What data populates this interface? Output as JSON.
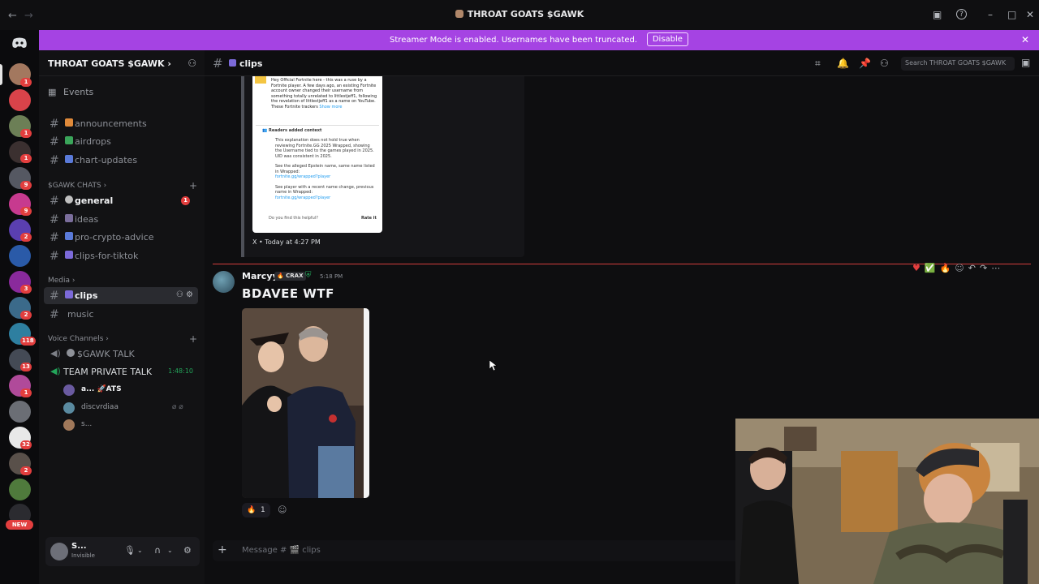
{
  "window": {
    "title": "THROAT GOATS $GAWK",
    "nav_back": "←",
    "nav_forward": "→",
    "controls": {
      "inbox": "▣",
      "help": "?",
      "minimize": "–",
      "maximize": "□",
      "close": "✕"
    }
  },
  "banner": {
    "text": "Streamer Mode is enabled. Usernames have been truncated.",
    "button": "Disable",
    "close": "✕"
  },
  "rail": {
    "home_icon": "discord-icon",
    "badges": [
      "1",
      "1",
      "1",
      "9",
      "9",
      "2",
      "3",
      "2",
      "1",
      "118",
      "13",
      "1",
      "32",
      "2"
    ],
    "new_label": "NEW"
  },
  "sidebar": {
    "server_name": "THROAT GOATS $GAWK ›",
    "events": "Events",
    "channels_top": [
      {
        "label": "announcements"
      },
      {
        "label": "airdrops"
      },
      {
        "label": "chart-updates"
      }
    ],
    "cat_chats": "$GAWK CHATS ›",
    "chats": [
      {
        "label": "general",
        "badge": "1"
      },
      {
        "label": "ideas"
      },
      {
        "label": "pro-crypto-advice"
      },
      {
        "label": "clips-for-tiktok"
      }
    ],
    "cat_media": "Media ›",
    "media": [
      {
        "label": "clips"
      },
      {
        "label": "music"
      }
    ],
    "cat_voice": "Voice Channels ›",
    "voice": [
      {
        "label": "$GAWK TALK"
      },
      {
        "label": "TEAM PRIVATE TALK",
        "timer": "1:48:10"
      }
    ],
    "voice_users": [
      {
        "name": "a... 🚀ATS"
      },
      {
        "name": "discvrdiaa"
      },
      {
        "name": "s..."
      }
    ],
    "user": {
      "name": "S...",
      "status": "Invisible"
    }
  },
  "chat": {
    "channel": "clips",
    "search_placeholder": "Search THROAT GOATS $GAWK",
    "embed": {
      "tweet_text": "Hey Official Fortnite here - this was a ruse by a Fortnite player. A few days ago, an existing Fortnite account owner changed their username from something totally unrelated to littlestjeff1, following the revelation of littlestjeff1 as a name on YouTube. These Fortnite trackers",
      "show_more": "Show more",
      "readers_context": "Readers added context",
      "ctx1": "This explanation does not hold true when reviewing Fortnite.GG 2025 Wrapped, showing the Username tied to the games played in 2025. UID was consistent in 2025.",
      "ctx2": "See the alleged Epstein name, same name listed in Wrapped:",
      "ctx2_link": "fortnite.gg/wrapped?player",
      "ctx3": "See player with a recent name change, previous name in Wrapped:",
      "ctx3_link": "fortnite.gg/wrapped?player",
      "helpful": "Do you find this helpful?",
      "rate": "Rate it",
      "source": "X • Today at 4:27 PM"
    },
    "message": {
      "author": "Marcyy",
      "tag": "🔥 CRAX",
      "time": "5:18 PM",
      "content": "BDAVEE WTF",
      "reaction_emoji": "🔥",
      "reaction_count": "1"
    },
    "composer_placeholder": "Message # 🎬 clips"
  },
  "colors": {
    "banner": "#a543e3",
    "accent_red": "#e23e3e",
    "online_green": "#23a55a"
  }
}
